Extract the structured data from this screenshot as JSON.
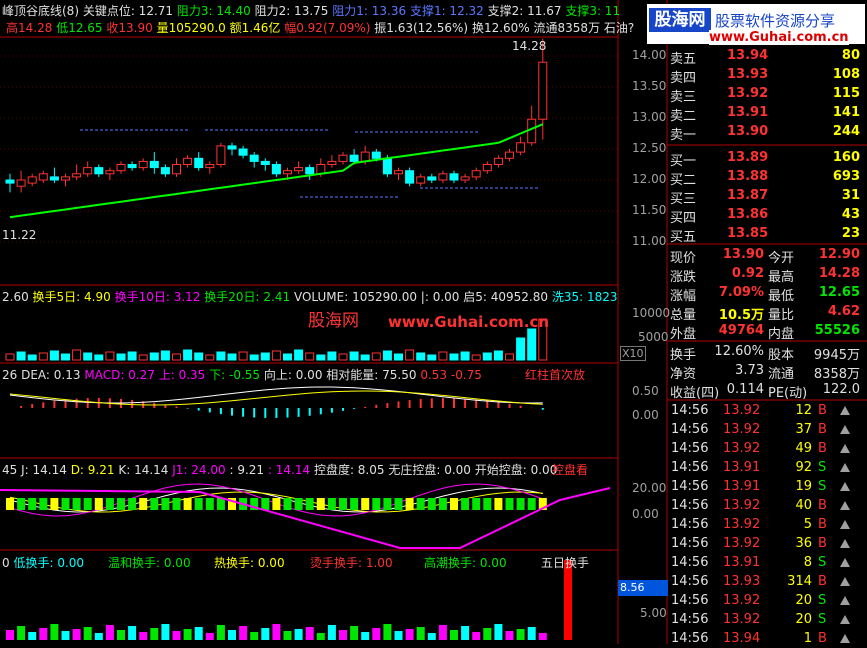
{
  "top": {
    "title": "峰顶谷底线(8)",
    "key_point": "关键点位: 12.71",
    "resist3": "阻力3: 14.40",
    "resist2": "阻力2: 13.75",
    "resist1": "阻力1: 13.36",
    "support1": "支撑1: 12.32",
    "support2": "支撑2: 11.67",
    "support3": "支撑3: 11"
  },
  "top2": {
    "high": "高14.28",
    "low": "低12.65",
    "close": "收13.90",
    "vol": "量105290.0",
    "amount": "额1.46亿",
    "range": "幅0.92(7.09%)",
    "amp": "振1.63(12.56%)",
    "turn": "换12.60%",
    "float": "流通8358万",
    "name": "石油?"
  },
  "logo": {
    "cn": "股海网",
    "slogan": "股票软件资源分享",
    "url": "www.Guhai.com.cn"
  },
  "watermark": {
    "cn": "股海网",
    "url": "www.Guhai.com.cn"
  },
  "price_axis": [
    "14.00",
    "13.50",
    "13.00",
    "12.50",
    "12.00",
    "11.50",
    "11.00"
  ],
  "price_labels": {
    "high_mark": "14.28",
    "low_mark": "11.22"
  },
  "vol_panel": {
    "a": "2.60",
    "t5": "换手5日: 4.90",
    "t10": "换手10日: 3.12",
    "t20": "换手20日: 2.41",
    "vol": "VOLUME: 105290.00",
    "i": "|: 0.00",
    "qi": "启5: 40952.80",
    "xi": "洗35: 1823",
    "axis": [
      "10000",
      "5000"
    ],
    "x10": "X10"
  },
  "macd_panel": {
    "a": "26",
    "dea": "DEA: 0.13",
    "macd": "MACD: 0.27",
    "up": "上: 0.35",
    "down": "下: -0.55",
    "up2": "向上: 0.00",
    "energy": "相对能量: 75.50",
    "v1": "0.53",
    "v2": "-0.75",
    "note": "红柱首次放",
    "axis": [
      "0.50",
      "0.00"
    ]
  },
  "kdj_panel": {
    "a": "45",
    "j": "J: 14.14",
    "d": "D: 9.21",
    "k": "K: 14.14",
    "j1": "J1: 24.00",
    "v": ": 9.21",
    "v2": ": 14.14",
    "ctrl": "控盘度: 8.05",
    "none": "无庄控盘: 0.00",
    "start": "开始控盘: 0.00",
    "ctrl2": "控盘看",
    "axis": [
      "20.00",
      "0.00"
    ]
  },
  "turn_panel": {
    "a": "0",
    "low": "低换手: 0.00",
    "mild": "温和换手: 0.00",
    "hot": "热换手: 0.00",
    "hotter": "烫手换手: 1.00",
    "peak": "高潮换手: 0.00",
    "five": "五日换手",
    "axis_box": "8.56",
    "axis": "5.00"
  },
  "order_book": {
    "sell": [
      {
        "label": "卖五",
        "price": "13.94",
        "vol": "80"
      },
      {
        "label": "卖四",
        "price": "13.93",
        "vol": "108"
      },
      {
        "label": "卖三",
        "price": "13.92",
        "vol": "115"
      },
      {
        "label": "卖二",
        "price": "13.91",
        "vol": "141"
      },
      {
        "label": "卖一",
        "price": "13.90",
        "vol": "244"
      }
    ],
    "buy": [
      {
        "label": "买一",
        "price": "13.89",
        "vol": "160"
      },
      {
        "label": "买二",
        "price": "13.88",
        "vol": "693"
      },
      {
        "label": "买三",
        "price": "13.87",
        "vol": "31"
      },
      {
        "label": "买四",
        "price": "13.86",
        "vol": "43"
      },
      {
        "label": "买五",
        "price": "13.85",
        "vol": "23"
      }
    ]
  },
  "stats": [
    {
      "l1": "现价",
      "v1": "13.90",
      "l2": "今开",
      "v2": "12.90"
    },
    {
      "l1": "涨跌",
      "v1": "0.92",
      "l2": "最高",
      "v2": "14.28"
    },
    {
      "l1": "涨幅",
      "v1": "7.09%",
      "l2": "最低",
      "v2": "12.65"
    },
    {
      "l1": "总量",
      "v1": "10.5万",
      "l2": "量比",
      "v2": "4.62"
    },
    {
      "l1": "外盘",
      "v1": "49764",
      "l2": "内盘",
      "v2": "55526"
    }
  ],
  "stats2": [
    {
      "l1": "换手",
      "v1": "12.60%",
      "l2": "股本",
      "v2": "9945万"
    },
    {
      "l1": "净资",
      "v1": "3.73",
      "l2": "流通",
      "v2": "8358万"
    },
    {
      "l1": "收益(四)",
      "v1": "0.114",
      "l2": "PE(动)",
      "v2": "122.0"
    }
  ],
  "ticks": [
    {
      "t": "14:56",
      "p": "13.92",
      "v": "12",
      "s": "B"
    },
    {
      "t": "14:56",
      "p": "13.92",
      "v": "37",
      "s": "B"
    },
    {
      "t": "14:56",
      "p": "13.92",
      "v": "49",
      "s": "B"
    },
    {
      "t": "14:56",
      "p": "13.91",
      "v": "92",
      "s": "S"
    },
    {
      "t": "14:56",
      "p": "13.91",
      "v": "19",
      "s": "S"
    },
    {
      "t": "14:56",
      "p": "13.92",
      "v": "40",
      "s": "B"
    },
    {
      "t": "14:56",
      "p": "13.92",
      "v": "5",
      "s": "B"
    },
    {
      "t": "14:56",
      "p": "13.92",
      "v": "36",
      "s": "B"
    },
    {
      "t": "14:56",
      "p": "13.91",
      "v": "8",
      "s": "S"
    },
    {
      "t": "14:56",
      "p": "13.93",
      "v": "314",
      "s": "B"
    },
    {
      "t": "14:56",
      "p": "13.92",
      "v": "20",
      "s": "S"
    },
    {
      "t": "14:56",
      "p": "13.92",
      "v": "20",
      "s": "S"
    },
    {
      "t": "14:56",
      "p": "13.94",
      "v": "1",
      "s": "B"
    }
  ],
  "colors": {
    "up": "#ff3232",
    "down": "#00e600",
    "accent": "#ffff00"
  }
}
